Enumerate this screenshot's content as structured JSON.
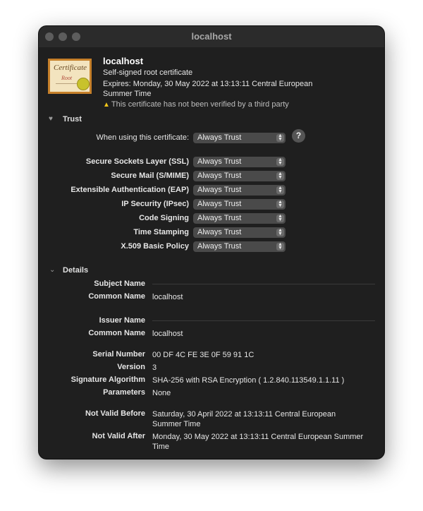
{
  "window": {
    "title": "localhost"
  },
  "header": {
    "name": "localhost",
    "type": "Self-signed root certificate",
    "expires": "Expires: Monday, 30 May 2022 at 13:13:11 Central European Summer Time",
    "warning": "This certificate has not been verified by a third party",
    "icon": {
      "title": "Certificate",
      "subtitle": "Root"
    }
  },
  "trust": {
    "section_label": "Trust",
    "when_using_label": "When using this certificate:",
    "when_using_value": "Always Trust",
    "help_label": "?",
    "rows": [
      {
        "label": "Secure Sockets Layer (SSL)",
        "value": "Always Trust"
      },
      {
        "label": "Secure Mail (S/MIME)",
        "value": "Always Trust"
      },
      {
        "label": "Extensible Authentication (EAP)",
        "value": "Always Trust"
      },
      {
        "label": "IP Security (IPsec)",
        "value": "Always Trust"
      },
      {
        "label": "Code Signing",
        "value": "Always Trust"
      },
      {
        "label": "Time Stamping",
        "value": "Always Trust"
      },
      {
        "label": "X.509 Basic Policy",
        "value": "Always Trust"
      }
    ]
  },
  "details": {
    "section_label": "Details",
    "subject_name_label": "Subject Name",
    "subject_common_name_label": "Common Name",
    "subject_common_name": "localhost",
    "issuer_name_label": "Issuer Name",
    "issuer_common_name_label": "Common Name",
    "issuer_common_name": "localhost",
    "serial_number_label": "Serial Number",
    "serial_number": "00 DF 4C FE 3E 0F 59 91 1C",
    "version_label": "Version",
    "version": "3",
    "signature_algorithm_label": "Signature Algorithm",
    "signature_algorithm": "SHA-256 with RSA Encryption ( 1.2.840.113549.1.1.11 )",
    "parameters_label": "Parameters",
    "parameters": "None",
    "not_valid_before_label": "Not Valid Before",
    "not_valid_before": "Saturday, 30 April 2022 at 13:13:11 Central European Summer Time",
    "not_valid_after_label": "Not Valid After",
    "not_valid_after": "Monday, 30 May 2022 at 13:13:11 Central European Summer Time"
  },
  "colors": {
    "window_bg": "#1f1f1f",
    "titlebar_bg": "#2b2b2b",
    "popup_bg": "#4a4a4a",
    "warning_accent": "#f0c419"
  }
}
